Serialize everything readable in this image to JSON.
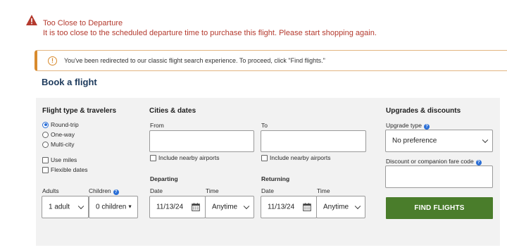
{
  "error": {
    "title": "Too Close to Departure",
    "message": "It is too close to the scheduled departure time to purchase this flight. Please start shopping again."
  },
  "notice": {
    "icon": "!",
    "text": "You've been redirected to our classic flight search experience. To proceed, click \"Find flights.\""
  },
  "page_title": "Book a flight",
  "flight_type": {
    "heading": "Flight type & travelers",
    "options": [
      {
        "label": "Round-trip",
        "selected": true
      },
      {
        "label": "One-way",
        "selected": false
      },
      {
        "label": "Multi-city",
        "selected": false
      }
    ],
    "checkboxes": [
      {
        "label": "Use miles",
        "checked": false
      },
      {
        "label": "Flexible dates",
        "checked": false
      }
    ],
    "adults_label": "Adults",
    "adults_value": "1 adult",
    "children_label": "Children",
    "children_value": "0 children",
    "info_glyph": "?"
  },
  "cities": {
    "heading": "Cities & dates",
    "from_label": "From",
    "from_value": "",
    "to_label": "To",
    "to_value": "",
    "nearby_label": "Include nearby airports",
    "departing_label": "Departing",
    "returning_label": "Returning",
    "date_label": "Date",
    "time_label": "Time",
    "depart_date": "11/13/24",
    "depart_time": "Anytime",
    "return_date": "11/13/24",
    "return_time": "Anytime"
  },
  "upgrades": {
    "heading": "Upgrades & discounts",
    "upgrade_label": "Upgrade type",
    "upgrade_value": "No preference",
    "discount_label": "Discount or companion fare code",
    "discount_value": ""
  },
  "find_button": "FIND FLIGHTS",
  "colors": {
    "error": "#b43a2e",
    "notice_accent": "#d88a2d",
    "title": "#1d3a5c",
    "button": "#4a7d2b",
    "radio_selected": "#2a6ed6"
  }
}
